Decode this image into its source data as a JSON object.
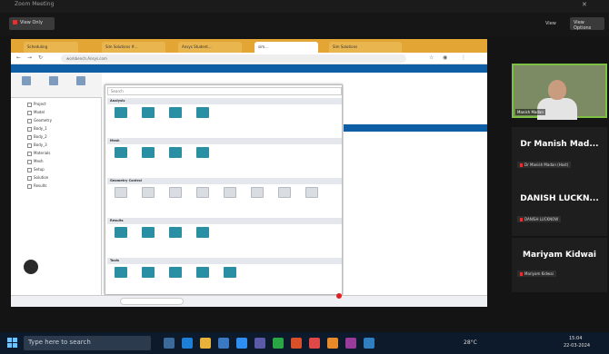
{
  "meeting": {
    "window_title": "Zoom Meeting",
    "control_button": "View Only",
    "view_label": "View",
    "view_button": "View Options"
  },
  "browser": {
    "tabs": [
      "Scheduling",
      "Sim Solutions #...",
      "Ansys Student...",
      "sim...",
      "Sim Solutions"
    ],
    "address": "workbench.Ansys.com",
    "popup_search": "Search"
  },
  "popup_sections": [
    "Analysis",
    "Mesh",
    "Geometry Control",
    "Results",
    "Tools"
  ],
  "left_tree": [
    "Project",
    "Model",
    "Geometry",
    "Body_1",
    "Body_2",
    "Body_3",
    "Materials",
    "Mesh",
    "Setup",
    "Solution",
    "Results"
  ],
  "participants": [
    {
      "name": "Dr Manish Mad...",
      "subtitle": "Dr Manish Madan (Host)"
    },
    {
      "name": "DANISH LUCKN...",
      "subtitle": "DANISH LUCKNOW"
    },
    {
      "name": "Mariyam Kidwai",
      "subtitle": "Mariyam Kidwai"
    }
  ],
  "camera_label": "Manish Madan",
  "taskbar": {
    "search": "Type here to search",
    "weather": "28°C",
    "time": "15:04",
    "date": "22-03-2024"
  },
  "colors": {
    "accent_blue": "#0e5ea6",
    "tab_orange": "#e3a534",
    "active_speaker": "#7bc043"
  }
}
